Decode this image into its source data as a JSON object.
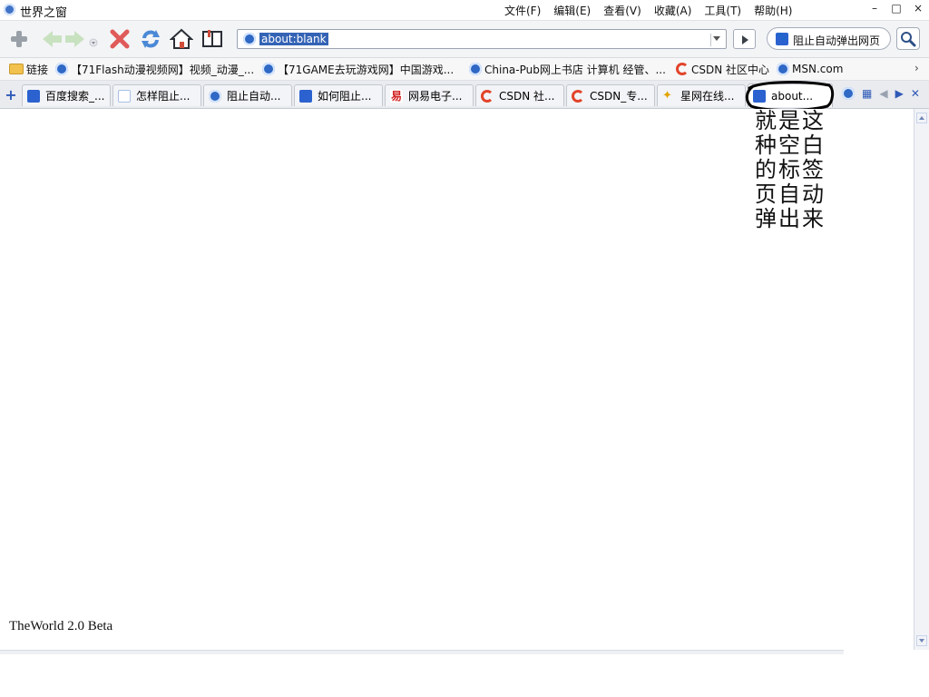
{
  "window": {
    "title": "世界之窗",
    "menu": [
      "文件(F)",
      "编辑(E)",
      "查看(V)",
      "收藏(A)",
      "工具(T)",
      "帮助(H)"
    ],
    "controls": [
      "–",
      "□",
      "×"
    ]
  },
  "toolbar": {
    "address": "about:blank",
    "popup_block_label": "阻止自动弹出网页"
  },
  "links": [
    {
      "label": "链接",
      "icon": "folder-icon"
    },
    {
      "label": "【71Flash动漫视频网】视频_动漫_...",
      "icon": "ie-icon"
    },
    {
      "label": "【71GAME去玩游戏网】中国游戏...",
      "icon": "ie-icon"
    },
    {
      "label": "China-Pub网上书店 计算机 经管、...",
      "icon": "ie-icon"
    },
    {
      "label": "CSDN 社区中心",
      "icon": "csdn-icon"
    },
    {
      "label": "MSN.com",
      "icon": "ie-icon"
    }
  ],
  "tabs": [
    {
      "label": "百度搜索_...",
      "icon": "baidu-paw-icon"
    },
    {
      "label": "怎样阻止...",
      "icon": "baidu-zhidao-icon"
    },
    {
      "label": "阻止自动...",
      "icon": "ie-icon"
    },
    {
      "label": "如何阻止...",
      "icon": "baidu-paw-icon"
    },
    {
      "label": "网易电子...",
      "icon": "netease-icon"
    },
    {
      "label": "CSDN 社...",
      "icon": "csdn-icon"
    },
    {
      "label": "CSDN_专...",
      "icon": "csdn-icon"
    },
    {
      "label": "星网在线...",
      "icon": "star-icon"
    },
    {
      "label": "about...",
      "icon": "baidu-paw-icon",
      "active": true
    }
  ],
  "content": {
    "annotation_lines": [
      "就是这",
      "种空白",
      "的标签",
      "页自动",
      "弹出来"
    ],
    "version": "TheWorld 2.0 Beta"
  }
}
